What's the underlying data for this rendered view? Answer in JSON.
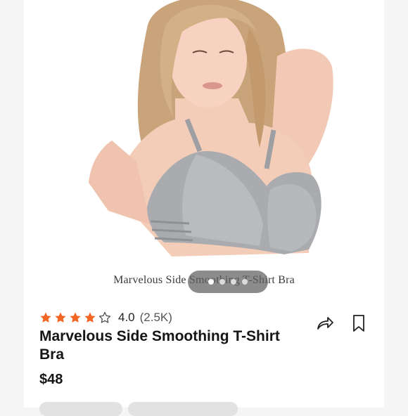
{
  "product": {
    "image_caption": "Marvelous Side Smoothing T-Shirt Bra",
    "title": "Marvelous Side Smoothing T-Shirt Bra",
    "price": "$48",
    "rating": {
      "stars_filled": 4,
      "stars_total": 5,
      "value": "4.0",
      "count": "(2.5K)"
    }
  },
  "carousel": {
    "dot_count": 4,
    "active_index": 0
  },
  "colors": {
    "star": "#f26522",
    "text": "#151515",
    "pill": "#5f5f5f"
  },
  "icons": [
    "share-arrow-icon",
    "bookmark-icon",
    "star-icon"
  ]
}
